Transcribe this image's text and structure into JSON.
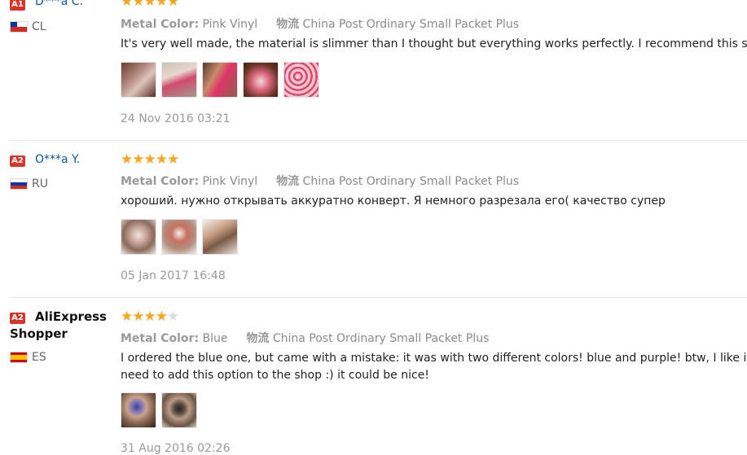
{
  "labels": {
    "metal_color_key": "Metal Color:",
    "shipping_key": "物流"
  },
  "colors": {
    "star": "#f5a623",
    "star_empty": "#dddddd",
    "name_link": "#0b58a6",
    "badge_a1": "#d9342b",
    "badge_a2": "#d9342b"
  },
  "reviews": [
    {
      "badge": "A1",
      "name": "D***a C.",
      "country": "CL",
      "flag": "chile",
      "rating": 5,
      "metal_color": "Pink Vinyl",
      "shipping": "China Post Ordinary Small Packet Plus",
      "text": "It's very well made, the material is slimmer than I thought but everything works perfectly. I recommend this seller.",
      "photos": [
        "photo-1",
        "photo-2",
        "photo-3",
        "photo-4",
        "photo-5"
      ],
      "date": "24 Nov 2016 03:21"
    },
    {
      "badge": "A2",
      "name": "O***a Y.",
      "country": "RU",
      "flag": "russia",
      "rating": 5,
      "metal_color": "Pink Vinyl",
      "shipping": "China Post Ordinary Small Packet Plus",
      "text": "хороший. нужно открывать аккуратно конверт. Я немного разрезала его( качество супер",
      "photos": [
        "photo-1",
        "photo-2",
        "photo-3"
      ],
      "date": "05 Jan 2017 16:48"
    },
    {
      "badge": "A2",
      "name_line1": "AliExpress",
      "name_line2": "Shopper",
      "country": "ES",
      "flag": "spain",
      "rating": 4,
      "metal_color": "Blue",
      "shipping": "China Post Ordinary Small Packet Plus",
      "text_line1": "I ordered the blue one, but came with a mistake: it was with two different colors! blue and purple! btw, I like it! I thi",
      "text_line2": "need to add this option to the shop :) it could be nice!",
      "photos": [
        "photo-1",
        "photo-2"
      ],
      "date": "31 Aug 2016 02:26"
    }
  ]
}
